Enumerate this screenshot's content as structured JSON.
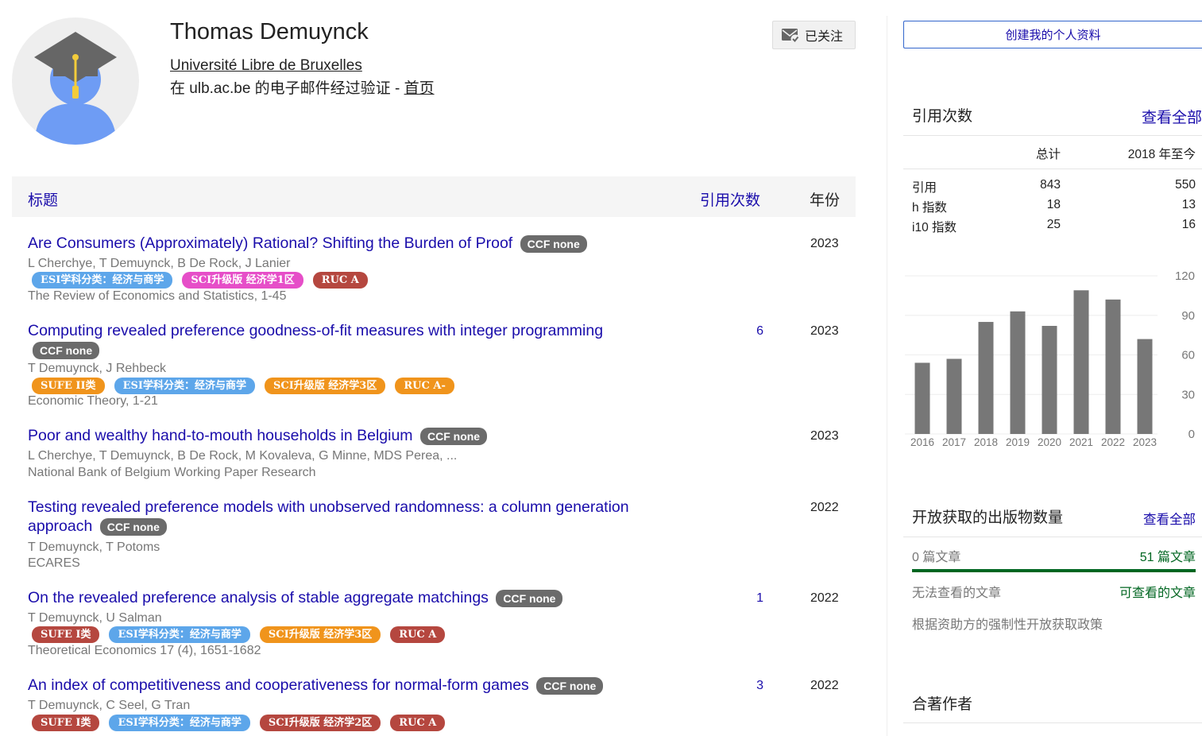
{
  "profile": {
    "name": "Thomas Demuynck",
    "affiliation": "Université Libre de Bruxelles",
    "verified_prefix": "在 ulb.ac.be 的电子邮件经过验证 - ",
    "homepage_label": "首页",
    "follow_label": "已关注"
  },
  "table": {
    "col_title": "标题",
    "col_cites": "引用次数",
    "col_year": "年份"
  },
  "tag_colors": {
    "ccf": "#6b6b6b",
    "esi": "#5da6ea",
    "sci1": "#e64ec8",
    "ruc_a": "#b5473f",
    "orange": "#f0941c",
    "sufe1": "#b5473f",
    "sci2": "#b5473f"
  },
  "articles": [
    {
      "title": "Are Consumers (Approximately) Rational? Shifting the Burden of Proof",
      "ccf": "CCF none",
      "authors": "L Cherchye, T Demuynck, B De Rock, J Lanier",
      "tags": [
        {
          "label": "ESI学科分类：经济与商学",
          "color": "#5da6ea"
        },
        {
          "label": "SCI升级版 经济学1区",
          "color": "#e64ec8"
        },
        {
          "label": "RUC A",
          "color": "#b5473f"
        }
      ],
      "venue": "The Review of Economics and Statistics, 1-45",
      "cites": "",
      "year": "2023"
    },
    {
      "title": "Computing revealed preference goodness-of-fit measures with integer programming",
      "ccf": "CCF none",
      "authors": "T Demuynck, J Rehbeck",
      "tags": [
        {
          "label": "SUFE II类",
          "color": "#f0941c"
        },
        {
          "label": "ESI学科分类：经济与商学",
          "color": "#5da6ea"
        },
        {
          "label": "SCI升级版 经济学3区",
          "color": "#f0941c"
        },
        {
          "label": "RUC A-",
          "color": "#f0941c"
        }
      ],
      "venue": "Economic Theory, 1-21",
      "cites": "6",
      "year": "2023"
    },
    {
      "title": "Poor and wealthy hand-to-mouth households in Belgium",
      "ccf": "CCF none",
      "authors": "L Cherchye, T Demuynck, B De Rock, M Kovaleva, G Minne, MDS Perea, ...",
      "tags": [],
      "venue": "National Bank of Belgium Working Paper Research",
      "cites": "",
      "year": "2023"
    },
    {
      "title": "Testing revealed preference models with unobserved randomness: a column generation approach",
      "ccf": "CCF none",
      "authors": "T Demuynck, T Potoms",
      "tags": [],
      "venue": "ECARES",
      "cites": "",
      "year": "2022"
    },
    {
      "title": "On the revealed preference analysis of stable aggregate matchings",
      "ccf": "CCF none",
      "authors": "T Demuynck, U Salman",
      "tags": [
        {
          "label": "SUFE I类",
          "color": "#b5473f"
        },
        {
          "label": "ESI学科分类：经济与商学",
          "color": "#5da6ea"
        },
        {
          "label": "SCI升级版 经济学3区",
          "color": "#f0941c"
        },
        {
          "label": "RUC A",
          "color": "#b5473f"
        }
      ],
      "venue": "Theoretical Economics 17 (4), 1651-1682",
      "cites": "1",
      "year": "2022"
    },
    {
      "title": "An index of competitiveness and cooperativeness for normal-form games",
      "ccf": "CCF none",
      "authors": "T Demuynck, C Seel, G Tran",
      "tags": [
        {
          "label": "SUFE I类",
          "color": "#b5473f"
        },
        {
          "label": "ESI学科分类：经济与商学",
          "color": "#5da6ea"
        },
        {
          "label": "SCI升级版 经济学2区",
          "color": "#b5473f"
        },
        {
          "label": "RUC A",
          "color": "#b5473f"
        }
      ],
      "venue": "",
      "cites": "3",
      "year": "2022"
    }
  ],
  "sidebar": {
    "create_profile": "创建我的个人资料",
    "citations": {
      "heading": "引用次数",
      "view_all": "查看全部",
      "col_total": "总计",
      "col_since": "2018 年至今",
      "rows": [
        {
          "label": "引用",
          "total": "843",
          "since": "550"
        },
        {
          "label": "h 指数",
          "total": "18",
          "since": "13"
        },
        {
          "label": "i10 指数",
          "total": "25",
          "since": "16"
        }
      ]
    },
    "open_access": {
      "heading": "开放获取的出版物数量",
      "view_all": "查看全部",
      "left_count": "0 篇文章",
      "right_count": "51 篇文章",
      "left_label": "无法查看的文章",
      "right_label": "可查看的文章",
      "mandate": "根据资助方的强制性开放获取政策",
      "available_fraction": 1.0
    },
    "coauthors": {
      "heading": "合著作者"
    }
  },
  "chart_data": {
    "type": "bar",
    "categories": [
      "2016",
      "2017",
      "2018",
      "2019",
      "2020",
      "2021",
      "2022",
      "2023"
    ],
    "values": [
      54,
      57,
      85,
      93,
      82,
      109,
      102,
      72
    ],
    "yticks": [
      "120",
      "90",
      "60",
      "30",
      "0"
    ],
    "ylim": [
      0,
      120
    ],
    "bar_color": "#777777",
    "grid": true
  }
}
